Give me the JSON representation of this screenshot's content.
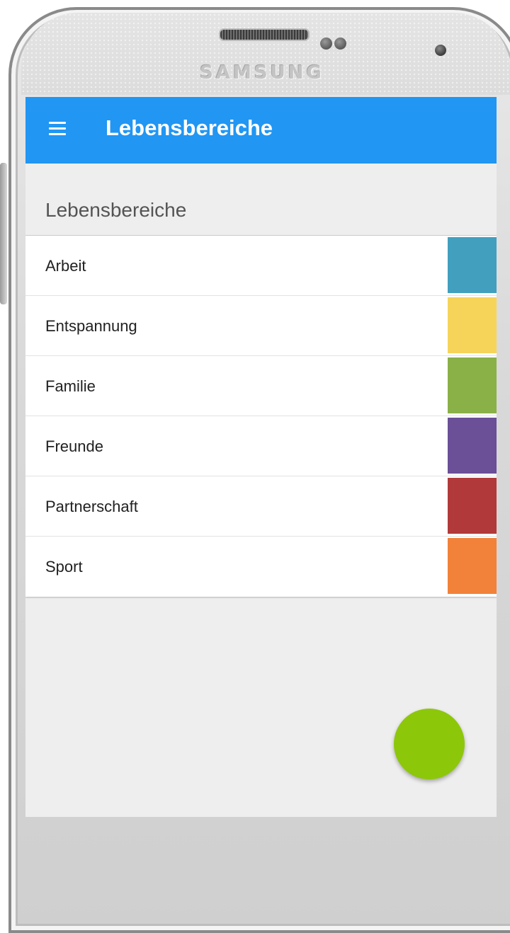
{
  "device": {
    "brand": "SAMSUNG"
  },
  "app_bar": {
    "title": "Lebensbereiche",
    "menu_icon": "hamburger-menu-icon",
    "background_color": "#2196f3"
  },
  "section": {
    "title": "Lebensbereiche"
  },
  "items": [
    {
      "label": "Arbeit",
      "color": "#429fbe"
    },
    {
      "label": "Entspannung",
      "color": "#f6d45a"
    },
    {
      "label": "Familie",
      "color": "#8ab048"
    },
    {
      "label": "Freunde",
      "color": "#6b4f97"
    },
    {
      "label": "Partnerschaft",
      "color": "#b2393a"
    },
    {
      "label": "Sport",
      "color": "#f2823a"
    }
  ],
  "fab": {
    "color": "#8dc70a",
    "icon": "add-icon"
  }
}
